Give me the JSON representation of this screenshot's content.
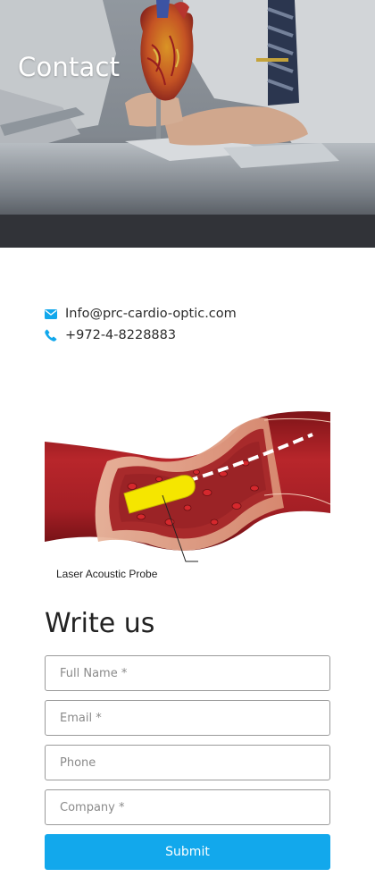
{
  "hero": {
    "title": "Contact"
  },
  "contact": {
    "email": {
      "icon": "envelope-icon",
      "text": "Info@prc-cardio-optic.com"
    },
    "phone": {
      "icon": "phone-icon",
      "text": "+972-4-8228883"
    },
    "icon_color": "#12a8ec"
  },
  "illustration": {
    "label": "Laser Acoustic Probe"
  },
  "form": {
    "title": "Write us",
    "full_name": {
      "placeholder": "Full Name *",
      "value": ""
    },
    "email": {
      "placeholder": "Email *",
      "value": ""
    },
    "phone": {
      "placeholder": "Phone",
      "value": ""
    },
    "company": {
      "placeholder": "Company *",
      "value": ""
    },
    "submit_label": "Submit",
    "accent_color": "#12a8ec"
  }
}
